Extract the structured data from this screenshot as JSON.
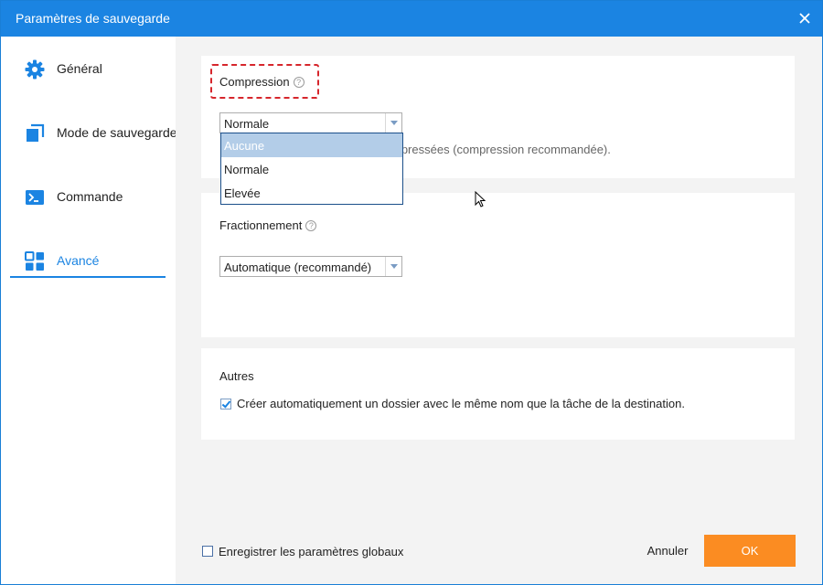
{
  "window": {
    "title": "Paramètres de sauvegarde"
  },
  "sidebar": {
    "items": [
      {
        "label": "Général",
        "icon": "gear-icon"
      },
      {
        "label": "Mode de sauvegarde",
        "icon": "copy-icon"
      },
      {
        "label": "Commande",
        "icon": "terminal-icon"
      },
      {
        "label": "Avancé",
        "icon": "grid-icon",
        "active": true
      }
    ]
  },
  "compression": {
    "title": "Compression",
    "help": "?",
    "selected": "Normale",
    "description_visible": "mpressées (compression recommandée).",
    "options": [
      "Aucune",
      "Normale",
      "Elevée"
    ],
    "highlighted_option": "Aucune"
  },
  "splitting": {
    "title": "Fractionnement",
    "help": "?",
    "selected": "Automatique (recommandé)"
  },
  "others": {
    "title": "Autres",
    "checkbox_label": "Créer automatiquement un dossier avec le même nom que la tâche de la destination.",
    "checked": true
  },
  "footer": {
    "save_global_label": "Enregistrer les paramètres globaux",
    "save_global_checked": false,
    "cancel_label": "Annuler",
    "ok_label": "OK"
  },
  "colors": {
    "titlebar": "#1b84e2",
    "accent": "#1b84e2",
    "ok_button": "#fb8c22",
    "highlight_border": "#d6262c"
  }
}
